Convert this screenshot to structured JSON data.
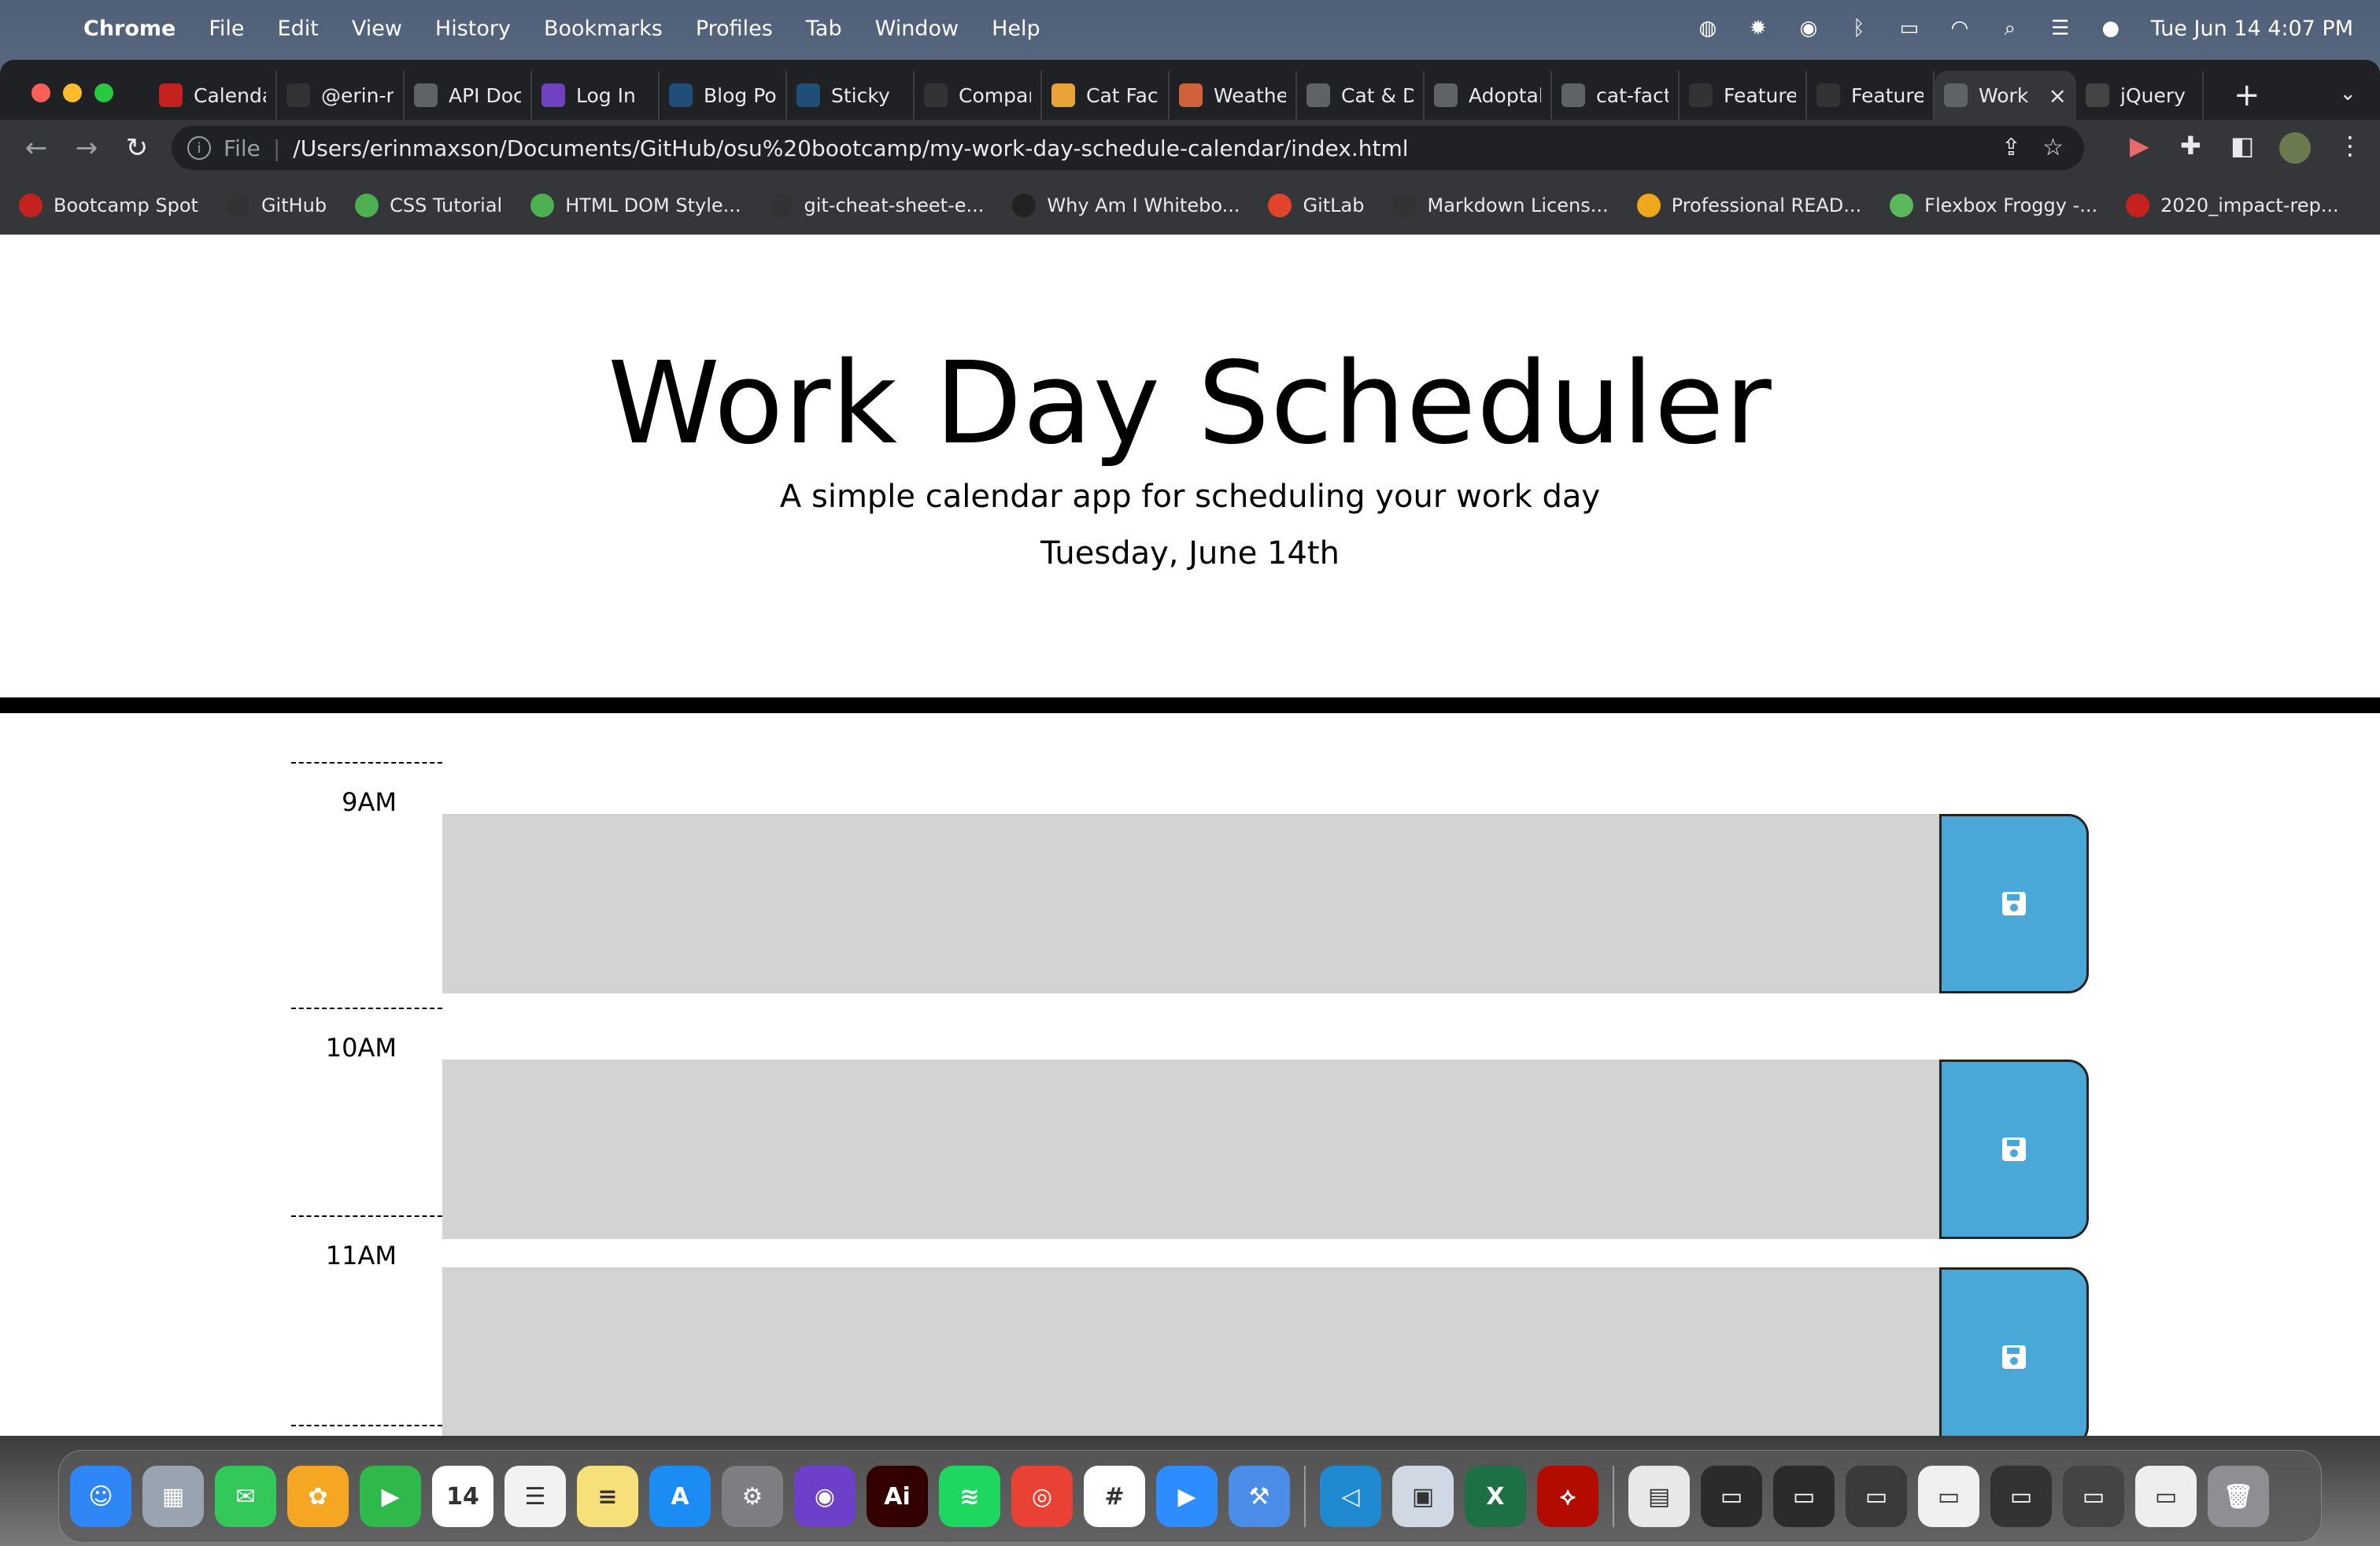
{
  "menubar": {
    "app_name": "Chrome",
    "items": [
      "File",
      "Edit",
      "View",
      "History",
      "Bookmarks",
      "Profiles",
      "Tab",
      "Window",
      "Help"
    ],
    "clock": "Tue Jun 14  4:07 PM"
  },
  "tabs": [
    {
      "label": "Calendar",
      "icon": "calendar-favicon",
      "color": "#c5221f"
    },
    {
      "label": "@erin-maxson",
      "icon": "github-favicon",
      "color": "#333333"
    },
    {
      "label": "API Docs",
      "icon": "globe-favicon",
      "color": "#5f6368"
    },
    {
      "label": "Log In",
      "icon": "pf-favicon",
      "color": "#6f42c1"
    },
    {
      "label": "Blog Posts",
      "icon": "f-favicon",
      "color": "#1f4e79"
    },
    {
      "label": "Sticky",
      "icon": "f-favicon",
      "color": "#1f4e79"
    },
    {
      "label": "Compare",
      "icon": "github-favicon",
      "color": "#333333"
    },
    {
      "label": "Cat Facts",
      "icon": "cat-favicon",
      "color": "#e8a33b"
    },
    {
      "label": "Weather",
      "icon": "weather-favicon",
      "color": "#d0623a"
    },
    {
      "label": "Cat & Dog",
      "icon": "globe-favicon",
      "color": "#5f6368"
    },
    {
      "label": "Adoptable",
      "icon": "globe-favicon",
      "color": "#5f6368"
    },
    {
      "label": "cat-facts",
      "icon": "globe-favicon",
      "color": "#5f6368"
    },
    {
      "label": "Feature",
      "icon": "github-favicon",
      "color": "#333333"
    },
    {
      "label": "Feature",
      "icon": "github-favicon",
      "color": "#333333"
    },
    {
      "label": "Work Day",
      "icon": "globe-favicon",
      "color": "#5f6368",
      "active": true
    },
    {
      "label": "jQuery",
      "icon": "jquery-favicon",
      "color": "#444444"
    }
  ],
  "address": {
    "scheme": "File",
    "url": "/Users/erinmaxson/Documents/GitHub/osu%20bootcamp/my-work-day-schedule-calendar/index.html"
  },
  "bookmarks": [
    {
      "label": "Bootcamp Spot",
      "icon": "bootcamp-favicon",
      "color": "#c5221f"
    },
    {
      "label": "GitHub",
      "icon": "github-favicon",
      "color": "#333333"
    },
    {
      "label": "CSS Tutorial",
      "icon": "w3-favicon",
      "color": "#4caf50"
    },
    {
      "label": "HTML DOM Style...",
      "icon": "w3-favicon",
      "color": "#4caf50"
    },
    {
      "label": "git-cheat-sheet-e...",
      "icon": "github-favicon",
      "color": "#333333"
    },
    {
      "label": "Why Am I Whitebo...",
      "icon": "book-favicon",
      "color": "#222222"
    },
    {
      "label": "GitLab",
      "icon": "gitlab-favicon",
      "color": "#e24329"
    },
    {
      "label": "Markdown Licens...",
      "icon": "github-favicon",
      "color": "#333333"
    },
    {
      "label": "Professional READ...",
      "icon": "fs-favicon",
      "color": "#f0a71b"
    },
    {
      "label": "Flexbox Froggy -...",
      "icon": "frog-favicon",
      "color": "#5cb85c"
    },
    {
      "label": "2020_impact-rep...",
      "icon": "pdf-favicon",
      "color": "#c5221f"
    }
  ],
  "page": {
    "title": "Work Day Scheduler",
    "lead": "A simple calendar app for scheduling your work day",
    "current_date": "Tuesday, June 14th"
  },
  "time_blocks": [
    {
      "hour": "9AM",
      "text": ""
    },
    {
      "hour": "10AM",
      "text": ""
    },
    {
      "hour": "11AM",
      "text": ""
    }
  ],
  "colors": {
    "past_block": "#d3d3d3",
    "save_button": "#4aa8d8"
  },
  "dock": [
    {
      "name": "finder-icon",
      "color": "#2f86f6",
      "glyph": "☺"
    },
    {
      "name": "launchpad-icon",
      "color": "#9aa3b0",
      "glyph": "▦"
    },
    {
      "name": "messages-icon",
      "color": "#34c759",
      "glyph": "✉"
    },
    {
      "name": "photos-icon",
      "color": "#f5a623",
      "glyph": "✿"
    },
    {
      "name": "facetime-icon",
      "color": "#30b94b",
      "glyph": "▶"
    },
    {
      "name": "calendar-icon",
      "color": "#ffffff",
      "glyph": "14",
      "dark": true
    },
    {
      "name": "reminders-icon",
      "color": "#f2f2f2",
      "glyph": "☰",
      "dark": true
    },
    {
      "name": "notes-icon",
      "color": "#f7e07a",
      "glyph": "≡",
      "dark": true
    },
    {
      "name": "app-store-icon",
      "color": "#1c8cf5",
      "glyph": "A"
    },
    {
      "name": "system-preferences-icon",
      "color": "#7d7d82",
      "glyph": "⚙"
    },
    {
      "name": "github-desktop-icon",
      "color": "#6e40c9",
      "glyph": "◉"
    },
    {
      "name": "illustrator-icon",
      "color": "#330000",
      "glyph": "Ai"
    },
    {
      "name": "spotify-icon",
      "color": "#1ed760",
      "glyph": "≋"
    },
    {
      "name": "chrome-icon",
      "color": "#e94235",
      "glyph": "◎"
    },
    {
      "name": "slack-icon",
      "color": "#ffffff",
      "glyph": "#",
      "dark": true
    },
    {
      "name": "zoom-icon",
      "color": "#2d8cff",
      "glyph": "▶"
    },
    {
      "name": "xcode-icon",
      "color": "#4a8de8",
      "glyph": "⚒"
    },
    {
      "name": "separator"
    },
    {
      "name": "vscode-icon",
      "color": "#1f8ad2",
      "glyph": "◁"
    },
    {
      "name": "preview-icon",
      "color": "#cfd8e3",
      "glyph": "▣",
      "dark": true
    },
    {
      "name": "excel-icon",
      "color": "#1d7044",
      "glyph": "X"
    },
    {
      "name": "acrobat-icon",
      "color": "#b30b00",
      "glyph": "⟡"
    },
    {
      "name": "separator"
    },
    {
      "name": "zip-file-icon",
      "color": "#e8e8e8",
      "glyph": "▤",
      "dark": true
    },
    {
      "name": "window-thumb-icon",
      "color": "#2b2b2b",
      "glyph": "▭"
    },
    {
      "name": "window-thumb-icon",
      "color": "#2b2b2b",
      "glyph": "▭"
    },
    {
      "name": "window-thumb-icon",
      "color": "#3a3a3a",
      "glyph": "▭"
    },
    {
      "name": "window-thumb-icon",
      "color": "#f0f0f0",
      "glyph": "▭",
      "dark": true
    },
    {
      "name": "window-thumb-icon",
      "color": "#333333",
      "glyph": "▭"
    },
    {
      "name": "window-thumb-icon",
      "color": "#444444",
      "glyph": "▭"
    },
    {
      "name": "window-thumb-icon",
      "color": "#eeeeee",
      "glyph": "▭",
      "dark": true
    },
    {
      "name": "trash-icon",
      "color": "#8e8e93",
      "glyph": "🗑"
    }
  ]
}
